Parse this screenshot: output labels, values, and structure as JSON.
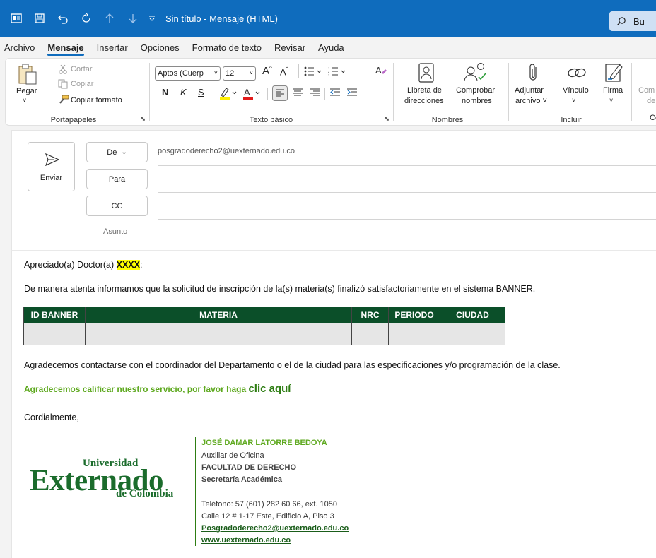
{
  "titlebar": {
    "title": "Sin título  -  Mensaje (HTML)",
    "search_text": "Bu"
  },
  "menu": {
    "items": [
      "Archivo",
      "Mensaje",
      "Insertar",
      "Opciones",
      "Formato de texto",
      "Revisar",
      "Ayuda"
    ],
    "active": "Mensaje"
  },
  "ribbon": {
    "clipboard": {
      "paste": "Pegar",
      "cut": "Cortar",
      "copy": "Copiar",
      "format_painter": "Copiar formato",
      "label": "Portapapeles"
    },
    "basic_text": {
      "font": "Aptos (Cuerp",
      "size": "12",
      "bold": "N",
      "italic": "K",
      "underline": "S",
      "label": "Texto básico"
    },
    "names": {
      "address_book": [
        "Libreta de",
        "direcciones"
      ],
      "check_names": [
        "Comprobar",
        "nombres"
      ],
      "label": "Nombres"
    },
    "include": {
      "attach": [
        "Adjuntar",
        "archivo ˅"
      ],
      "link": "Vínculo",
      "signature": "Firma",
      "label": "Incluir"
    },
    "next_group": {
      "text1": "Com",
      "text2": "de",
      "label": "Co"
    }
  },
  "compose": {
    "send": "Enviar",
    "from_label": "De",
    "from_address": "posgradoderecho2@uexternado.edu.co",
    "to_label": "Para",
    "cc_label": "CC",
    "subject_label": "Asunto"
  },
  "body": {
    "greeting_prefix": "Apreciado(a) Doctor(a) ",
    "greeting_name": "XXXX",
    "greeting_suffix": ":",
    "paragraph1": "De manera atenta informamos que la solicitud de inscripción de la(s) materia(s) finalizó satisfactoriamente en el sistema BANNER.",
    "table_headers": [
      "ID BANNER",
      "MATERIA",
      "NRC",
      "PERIODO",
      "CIUDAD"
    ],
    "paragraph2": "Agradecemos contactarse con el coordinador del Departamento o el de la ciudad para las especificaciones y/o programación de la clase.",
    "rating_text": "Agradecemos calificar nuestro servicio, por favor haga ",
    "rating_link": "clic aquí",
    "closing": "Cordialmente,"
  },
  "signature": {
    "logo_top": "Universidad",
    "logo_main": "Externado",
    "logo_bottom": "de Colombia",
    "name": "JOSÉ DAMAR LATORRE BEDOYA",
    "role": "Auxiliar de Oficina",
    "faculty": "FACULTAD DE DERECHO",
    "office": "Secretaría Académica",
    "phone": "Teléfono: 57 (601) 282 60 66, ext. 1050",
    "address": "Calle 12 # 1-17 Este, Edificio A, Piso 3",
    "email": "Posgradoderecho2@uexternado.edu.co",
    "web": "www.uexternado.edu.co"
  },
  "colors": {
    "titlebar": "#0f6cbd",
    "table_header": "#0b4f29",
    "highlight": "#ffff00",
    "green_text": "#5ea91f"
  }
}
